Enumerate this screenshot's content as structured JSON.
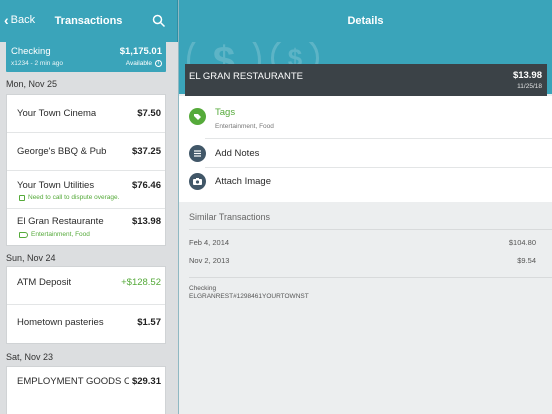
{
  "left_nav": {
    "back_label": "Back",
    "title": "Transactions"
  },
  "right_nav": {
    "title": "Details"
  },
  "account": {
    "name": "Checking",
    "balance": "$1,175.01",
    "subtitle": "x1234 - 2 min ago",
    "available_label": "Available"
  },
  "groups": [
    {
      "date": "Mon, Nov 25",
      "items": [
        {
          "title": "Your Town Cinema",
          "amount": "$7.50"
        },
        {
          "title": "George's BBQ & Pub",
          "amount": "$37.25"
        },
        {
          "title": "Your Town Utilities",
          "amount": "$76.46",
          "note": "Need to call to dispute overage."
        },
        {
          "title": "El Gran Restaurante",
          "amount": "$13.98",
          "tags": "Entertainment, Food"
        }
      ]
    },
    {
      "date": "Sun, Nov 24",
      "items": [
        {
          "title": "ATM Deposit",
          "amount": "+$128.52"
        },
        {
          "title": "Hometown pasteries",
          "amount": "$1.57"
        }
      ]
    },
    {
      "date": "Sat, Nov 23",
      "items": [
        {
          "title": "EMPLOYMENT GOODS O...",
          "amount": "$29.31"
        }
      ]
    }
  ],
  "detail": {
    "merchant": "EL GRAN RESTAURANTE",
    "amount": "$13.98",
    "date": "11/25/18",
    "tags_label": "Tags",
    "tags_value": "Entertainment, Food",
    "add_notes_label": "Add Notes",
    "attach_image_label": "Attach Image",
    "similar_header": "Similar Transactions",
    "similar": [
      {
        "date": "Feb 4, 2014",
        "amount": "$104.80"
      },
      {
        "date": "Nov 2, 2013",
        "amount": "$9.54"
      }
    ],
    "account_name": "Checking",
    "raw_description": "ELGRANREST#1298461YOURTOWNST"
  },
  "colors": {
    "accent": "#3aa4ba",
    "positive": "#55aa3a",
    "banner": "#3b4247",
    "icon_dark": "#415768"
  }
}
